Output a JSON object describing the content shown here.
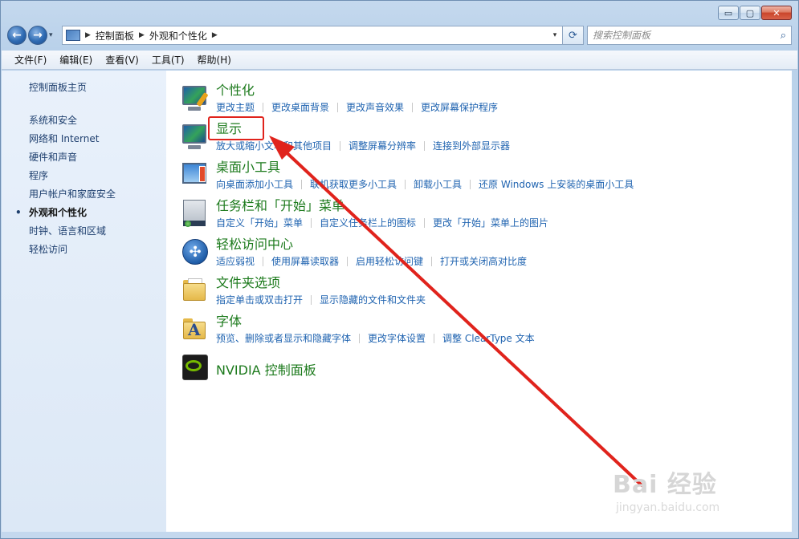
{
  "window": {
    "caption_buttons": {
      "minimize": "▭",
      "maximize": "▢",
      "close": "✕"
    }
  },
  "navbar": {
    "back_glyph": "←",
    "forward_glyph": "→",
    "dropdown_glyph": "▾",
    "breadcrumb": [
      "控制面板",
      "外观和个性化"
    ],
    "breadcrumb_sep": "▶",
    "refresh_glyph": "⟳",
    "search_placeholder": "搜索控制面板",
    "search_icon_glyph": "⌕"
  },
  "menubar": {
    "items": [
      "文件(F)",
      "编辑(E)",
      "查看(V)",
      "工具(T)",
      "帮助(H)"
    ]
  },
  "sidebar": {
    "home": "控制面板主页",
    "items": [
      "系统和安全",
      "网络和 Internet",
      "硬件和声音",
      "程序",
      "用户帐户和家庭安全",
      "外观和个性化",
      "时钟、语言和区域",
      "轻松访问"
    ],
    "active_index": 5,
    "bullet": "•"
  },
  "categories": [
    {
      "icon": "personalization-icon",
      "title": "个性化",
      "links": [
        "更改主题",
        "更改桌面背景",
        "更改声音效果",
        "更改屏幕保护程序"
      ]
    },
    {
      "icon": "display-icon",
      "title": "显示",
      "links": [
        "放大或缩小文本和其他项目",
        "调整屏幕分辨率",
        "连接到外部显示器"
      ]
    },
    {
      "icon": "desktop-gadgets-icon",
      "title": "桌面小工具",
      "links": [
        "向桌面添加小工具",
        "联机获取更多小工具",
        "卸载小工具",
        "还原 Windows 上安装的桌面小工具"
      ]
    },
    {
      "icon": "taskbar-icon",
      "title": "任务栏和「开始」菜单",
      "links": [
        "自定义「开始」菜单",
        "自定义任务栏上的图标",
        "更改「开始」菜单上的图片"
      ]
    },
    {
      "icon": "ease-of-access-icon",
      "title": "轻松访问中心",
      "links": [
        "适应弱视",
        "使用屏幕读取器",
        "启用轻松访问键",
        "打开或关闭高对比度"
      ]
    },
    {
      "icon": "folder-options-icon",
      "title": "文件夹选项",
      "links": [
        "指定单击或双击打开",
        "显示隐藏的文件和文件夹"
      ]
    },
    {
      "icon": "fonts-icon",
      "title": "字体",
      "links": [
        "预览、删除或者显示和隐藏字体",
        "更改字体设置",
        "调整 ClearType 文本"
      ]
    },
    {
      "icon": "nvidia-icon",
      "title": "NVIDIA 控制面板",
      "links": []
    }
  ],
  "annotation": {
    "color": "#e0231c"
  },
  "watermark": {
    "main": "Bai 经验",
    "sub": "jingyan.baidu.com"
  },
  "colors": {
    "category_title": "#1c7a1c",
    "link": "#1f63b0",
    "sidebar_link": "#1e3f6e"
  }
}
